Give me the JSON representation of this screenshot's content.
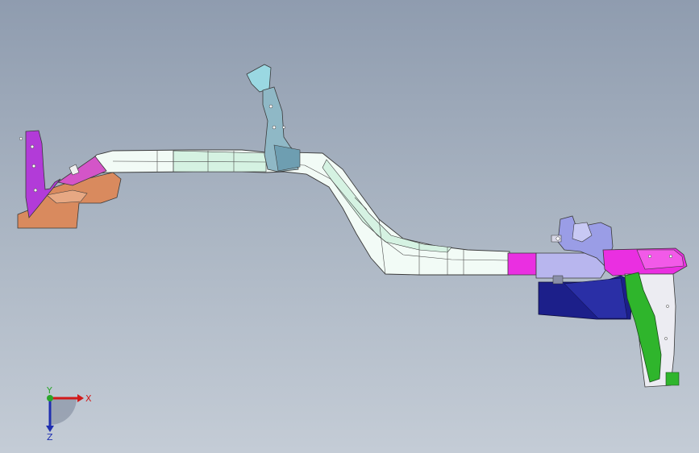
{
  "viewport": {
    "background_top": "#8f9caf",
    "background_bottom": "#c4ccd6"
  },
  "parts": {
    "main_rail_color": "#f2fbf6",
    "rail_tint_color": "#d5f2e2",
    "front_bracket_color": "#b23bd8",
    "front_lower_bracket_color": "#d98a5e",
    "front_gusset_color": "#d455c8",
    "mid_bracket_color": "#9ad8e2",
    "rear_pink_color": "#ea2fe1",
    "rear_lavender_color": "#b8b6ee",
    "rear_mount_color": "#9a9de6",
    "rear_navy_color": "#1c1f8a",
    "rear_green_color": "#2fb52c"
  },
  "triad": {
    "x_label": "X",
    "y_label": "Y",
    "z_label": "Z",
    "x_color": "#d21a1a",
    "y_color": "#2aa52a",
    "z_color": "#1f2fb0"
  }
}
